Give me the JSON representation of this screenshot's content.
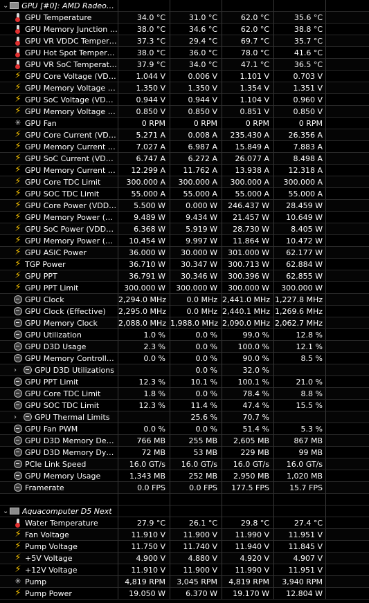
{
  "sections": [
    {
      "title": "GPU [#0]: AMD Radeon ...",
      "expanded": true,
      "rows": [
        {
          "icon": "thermometer-icon",
          "label": "GPU Temperature",
          "v": [
            "34.0 °C",
            "31.0 °C",
            "62.0 °C",
            "35.6 °C"
          ]
        },
        {
          "icon": "thermometer-icon",
          "label": "GPU Memory Junction Te...",
          "v": [
            "38.0 °C",
            "34.6 °C",
            "62.0 °C",
            "38.8 °C"
          ]
        },
        {
          "icon": "thermometer-icon",
          "label": "GPU VR VDDC Temperature",
          "v": [
            "37.3 °C",
            "29.4 °C",
            "69.7 °C",
            "35.7 °C"
          ]
        },
        {
          "icon": "thermometer-icon",
          "label": "GPU Hot Spot Temperature",
          "v": [
            "38.0 °C",
            "36.0 °C",
            "78.0 °C",
            "41.6 °C"
          ]
        },
        {
          "icon": "thermometer-icon",
          "label": "GPU VR SoC Temperature",
          "v": [
            "37.9 °C",
            "34.0 °C",
            "47.1 °C",
            "36.5 °C"
          ]
        },
        {
          "icon": "bolt-icon",
          "label": "GPU Core Voltage (VDDC...",
          "v": [
            "1.044 V",
            "0.006 V",
            "1.101 V",
            "0.703 V"
          ]
        },
        {
          "icon": "bolt-icon",
          "label": "GPU Memory Voltage (V...",
          "v": [
            "1.350 V",
            "1.350 V",
            "1.354 V",
            "1.351 V"
          ]
        },
        {
          "icon": "bolt-icon",
          "label": "GPU SoC Voltage (VDDC...",
          "v": [
            "0.944 V",
            "0.944 V",
            "1.104 V",
            "0.960 V"
          ]
        },
        {
          "icon": "bolt-icon",
          "label": "GPU Memory Voltage (V...",
          "v": [
            "0.850 V",
            "0.850 V",
            "0.851 V",
            "0.850 V"
          ]
        },
        {
          "icon": "fan-icon",
          "label": "GPU Fan",
          "v": [
            "0 RPM",
            "0 RPM",
            "0 RPM",
            "0 RPM"
          ]
        },
        {
          "icon": "bolt-icon",
          "label": "GPU Core Current (VDD...",
          "v": [
            "5.271 A",
            "0.008 A",
            "235.430 A",
            "26.356 A"
          ]
        },
        {
          "icon": "bolt-icon",
          "label": "GPU Memory Current (V...",
          "v": [
            "7.027 A",
            "6.987 A",
            "15.849 A",
            "7.883 A"
          ]
        },
        {
          "icon": "bolt-icon",
          "label": "GPU SoC Current (VDDC...",
          "v": [
            "6.747 A",
            "6.272 A",
            "26.077 A",
            "8.498 A"
          ]
        },
        {
          "icon": "bolt-icon",
          "label": "GPU Memory Current (V...",
          "v": [
            "12.299 A",
            "11.762 A",
            "13.938 A",
            "12.318 A"
          ]
        },
        {
          "icon": "bolt-icon",
          "label": "GPU Core TDC Limit",
          "v": [
            "300.000 A",
            "300.000 A",
            "300.000 A",
            "300.000 A"
          ]
        },
        {
          "icon": "bolt-icon",
          "label": "GPU SOC TDC Limit",
          "v": [
            "55.000 A",
            "55.000 A",
            "55.000 A",
            "55.000 A"
          ]
        },
        {
          "icon": "bolt-icon",
          "label": "GPU Core Power (VDDC...",
          "v": [
            "5.500 W",
            "0.000 W",
            "246.437 W",
            "28.459 W"
          ]
        },
        {
          "icon": "bolt-icon",
          "label": "GPU Memory Power (VD...",
          "v": [
            "9.489 W",
            "9.434 W",
            "21.457 W",
            "10.649 W"
          ]
        },
        {
          "icon": "bolt-icon",
          "label": "GPU SoC Power (VDDCR...",
          "v": [
            "6.368 W",
            "5.919 W",
            "28.730 W",
            "8.405 W"
          ]
        },
        {
          "icon": "bolt-icon",
          "label": "GPU Memory Power (VD...",
          "v": [
            "10.454 W",
            "9.997 W",
            "11.864 W",
            "10.472 W"
          ]
        },
        {
          "icon": "bolt-icon",
          "label": "GPU ASIC Power",
          "v": [
            "36.000 W",
            "30.000 W",
            "301.000 W",
            "62.177 W"
          ]
        },
        {
          "icon": "bolt-icon",
          "label": "TGP Power",
          "v": [
            "36.710 W",
            "30.347 W",
            "300.713 W",
            "62.884 W"
          ]
        },
        {
          "icon": "bolt-icon",
          "label": "GPU PPT",
          "v": [
            "36.791 W",
            "30.346 W",
            "300.396 W",
            "62.855 W"
          ]
        },
        {
          "icon": "bolt-icon",
          "label": "GPU PPT Limit",
          "v": [
            "300.000 W",
            "300.000 W",
            "300.000 W",
            "300.000 W"
          ]
        },
        {
          "icon": "clock-icon",
          "label": "GPU Clock",
          "v": [
            "2,294.0 MHz",
            "0.0 MHz",
            "2,441.0 MHz",
            "1,227.8 MHz"
          ]
        },
        {
          "icon": "clock-icon",
          "label": "GPU Clock (Effective)",
          "v": [
            "2,295.0 MHz",
            "0.0 MHz",
            "2,440.1 MHz",
            "1,269.6 MHz"
          ]
        },
        {
          "icon": "clock-icon",
          "label": "GPU Memory Clock",
          "v": [
            "2,088.0 MHz",
            "1,988.0 MHz",
            "2,090.0 MHz",
            "2,062.7 MHz"
          ]
        },
        {
          "icon": "clock-icon",
          "label": "GPU Utilization",
          "v": [
            "1.0 %",
            "0.0 %",
            "99.0 %",
            "12.8 %"
          ]
        },
        {
          "icon": "clock-icon",
          "label": "GPU D3D Usage",
          "v": [
            "2.3 %",
            "0.0 %",
            "100.0 %",
            "12.1 %"
          ]
        },
        {
          "icon": "clock-icon",
          "label": "GPU Memory Controller ...",
          "v": [
            "0.0 %",
            "0.0 %",
            "90.0 %",
            "8.5 %"
          ]
        },
        {
          "icon": "clock-icon",
          "label": "GPU D3D Utilizations",
          "v": [
            "",
            "0.0 %",
            "32.0 %",
            ""
          ],
          "group": true
        },
        {
          "icon": "clock-icon",
          "label": "GPU PPT Limit",
          "v": [
            "12.3 %",
            "10.1 %",
            "100.1 %",
            "21.0 %"
          ]
        },
        {
          "icon": "clock-icon",
          "label": "GPU Core TDC Limit",
          "v": [
            "1.8 %",
            "0.0 %",
            "78.4 %",
            "8.8 %"
          ]
        },
        {
          "icon": "clock-icon",
          "label": "GPU SOC TDC Limit",
          "v": [
            "12.3 %",
            "11.4 %",
            "47.4 %",
            "15.5 %"
          ]
        },
        {
          "icon": "clock-icon",
          "label": "GPU Thermal Limits",
          "v": [
            "",
            "25.6 %",
            "70.7 %",
            ""
          ],
          "group": true
        },
        {
          "icon": "clock-icon",
          "label": "GPU Fan PWM",
          "v": [
            "0.0 %",
            "0.0 %",
            "51.4 %",
            "5.3 %"
          ]
        },
        {
          "icon": "clock-icon",
          "label": "GPU D3D Memory Dedica...",
          "v": [
            "766 MB",
            "255 MB",
            "2,605 MB",
            "867 MB"
          ]
        },
        {
          "icon": "clock-icon",
          "label": "GPU D3D Memory Dynamic",
          "v": [
            "72 MB",
            "53 MB",
            "229 MB",
            "99 MB"
          ]
        },
        {
          "icon": "clock-icon",
          "label": "PCIe Link Speed",
          "v": [
            "16.0 GT/s",
            "16.0 GT/s",
            "16.0 GT/s",
            "16.0 GT/s"
          ]
        },
        {
          "icon": "clock-icon",
          "label": "GPU Memory Usage",
          "v": [
            "1,343 MB",
            "252 MB",
            "2,950 MB",
            "1,020 MB"
          ]
        },
        {
          "icon": "clock-icon",
          "label": "Framerate",
          "v": [
            "0.0 FPS",
            "0.0 FPS",
            "177.5 FPS",
            "15.7 FPS"
          ]
        }
      ]
    },
    {
      "title": "Aquacomputer D5 Next",
      "expanded": true,
      "rows": [
        {
          "icon": "thermometer-icon",
          "label": "Water Temperature",
          "v": [
            "27.9 °C",
            "26.1 °C",
            "29.8 °C",
            "27.4 °C"
          ]
        },
        {
          "icon": "bolt-icon",
          "label": "Fan Voltage",
          "v": [
            "11.910 V",
            "11.900 V",
            "11.990 V",
            "11.951 V"
          ]
        },
        {
          "icon": "bolt-icon",
          "label": "Pump Voltage",
          "v": [
            "11.750 V",
            "11.740 V",
            "11.940 V",
            "11.845 V"
          ]
        },
        {
          "icon": "bolt-icon",
          "label": "+5V Voltage",
          "v": [
            "4.900 V",
            "4.880 V",
            "4.920 V",
            "4.907 V"
          ]
        },
        {
          "icon": "bolt-icon",
          "label": "+12V Voltage",
          "v": [
            "11.910 V",
            "11.900 V",
            "11.990 V",
            "11.951 V"
          ]
        },
        {
          "icon": "fan-icon",
          "label": "Pump",
          "v": [
            "4,819 RPM",
            "3,045 RPM",
            "4,819 RPM",
            "3,940 RPM"
          ]
        },
        {
          "icon": "bolt-icon",
          "label": "Pump Power",
          "v": [
            "19.050 W",
            "6.370 W",
            "19.170 W",
            "12.804 W"
          ]
        }
      ]
    }
  ]
}
